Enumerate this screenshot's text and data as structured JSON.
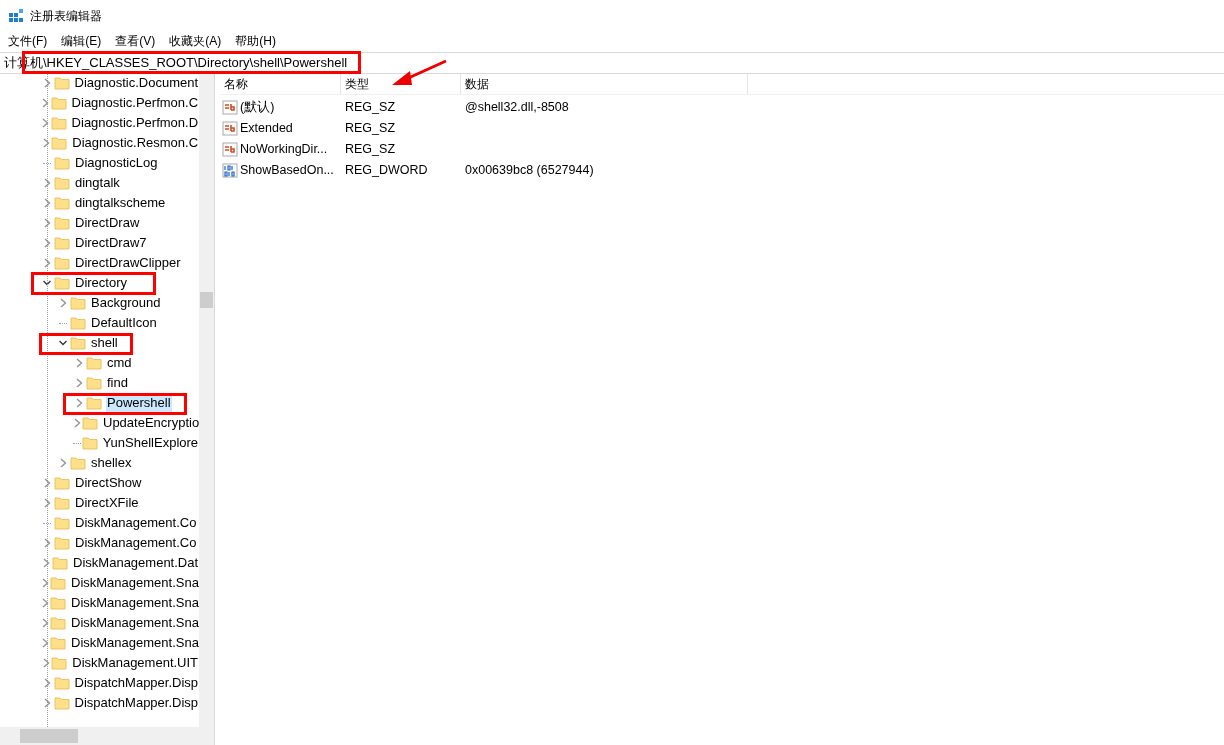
{
  "window": {
    "title": "注册表编辑器"
  },
  "menu": [
    "文件(F)",
    "编辑(E)",
    "查看(V)",
    "收藏夹(A)",
    "帮助(H)"
  ],
  "address": "计算机\\HKEY_CLASSES_ROOT\\Directory\\shell\\Powershell",
  "tree": [
    {
      "label": "Diagnostic.Document",
      "kind": "branch",
      "expanded": false,
      "selected": false
    },
    {
      "label": "Diagnostic.Perfmon.C",
      "kind": "branch",
      "expanded": false,
      "selected": false
    },
    {
      "label": "Diagnostic.Perfmon.D",
      "kind": "branch",
      "expanded": false,
      "selected": false
    },
    {
      "label": "Diagnostic.Resmon.C",
      "kind": "branch",
      "expanded": false,
      "selected": false
    },
    {
      "label": "DiagnosticLog",
      "kind": "leaf",
      "selected": false
    },
    {
      "label": "dingtalk",
      "kind": "branch",
      "expanded": false,
      "selected": false
    },
    {
      "label": "dingtalkscheme",
      "kind": "branch",
      "expanded": false,
      "selected": false
    },
    {
      "label": "DirectDraw",
      "kind": "branch",
      "expanded": false,
      "selected": false
    },
    {
      "label": "DirectDraw7",
      "kind": "branch",
      "expanded": false,
      "selected": false
    },
    {
      "label": "DirectDrawClipper",
      "kind": "branch",
      "expanded": false,
      "selected": false
    },
    {
      "label": "Directory",
      "kind": "branch",
      "expanded": true,
      "selected": false,
      "children": [
        {
          "label": "Background",
          "kind": "branch",
          "expanded": false,
          "selected": false
        },
        {
          "label": "DefaultIcon",
          "kind": "leaf",
          "selected": false
        },
        {
          "label": "shell",
          "kind": "branch",
          "expanded": true,
          "selected": false,
          "children": [
            {
              "label": "cmd",
              "kind": "branch",
              "expanded": false,
              "selected": false
            },
            {
              "label": "find",
              "kind": "branch",
              "expanded": false,
              "selected": false
            },
            {
              "label": "Powershell",
              "kind": "branch",
              "expanded": false,
              "selected": true
            },
            {
              "label": "UpdateEncryptio",
              "kind": "branch",
              "expanded": false,
              "selected": false
            },
            {
              "label": "YunShellExplore",
              "kind": "leaf",
              "selected": false
            }
          ]
        },
        {
          "label": "shellex",
          "kind": "branch",
          "expanded": false,
          "selected": false
        }
      ]
    },
    {
      "label": "DirectShow",
      "kind": "branch",
      "expanded": false,
      "selected": false
    },
    {
      "label": "DirectXFile",
      "kind": "branch",
      "expanded": false,
      "selected": false
    },
    {
      "label": "DiskManagement.Co",
      "kind": "leaf",
      "selected": false
    },
    {
      "label": "DiskManagement.Co",
      "kind": "branch",
      "expanded": false,
      "selected": false
    },
    {
      "label": "DiskManagement.Dat",
      "kind": "branch",
      "expanded": false,
      "selected": false
    },
    {
      "label": "DiskManagement.Sna",
      "kind": "branch",
      "expanded": false,
      "selected": false
    },
    {
      "label": "DiskManagement.Sna",
      "kind": "branch",
      "expanded": false,
      "selected": false
    },
    {
      "label": "DiskManagement.Sna",
      "kind": "branch",
      "expanded": false,
      "selected": false
    },
    {
      "label": "DiskManagement.Sna",
      "kind": "branch",
      "expanded": false,
      "selected": false
    },
    {
      "label": "DiskManagement.UIT",
      "kind": "branch",
      "expanded": false,
      "selected": false
    },
    {
      "label": "DispatchMapper.Disp",
      "kind": "branch",
      "expanded": false,
      "selected": false
    },
    {
      "label": "DispatchMapper.Disp",
      "kind": "branch",
      "expanded": false,
      "selected": false
    }
  ],
  "table": {
    "columns": [
      "名称",
      "类型",
      "数据"
    ],
    "rows": [
      {
        "kind": "string",
        "name": "(默认)",
        "type": "REG_SZ",
        "data": "@shell32.dll,-8508"
      },
      {
        "kind": "string",
        "name": "Extended",
        "type": "REG_SZ"
      },
      {
        "kind": "string",
        "name": "NoWorkingDir...",
        "type": "REG_SZ"
      },
      {
        "kind": "dword",
        "name": "ShowBasedOn...",
        "type": "REG_DWORD",
        "data": "0x00639bc8 (6527944)"
      }
    ]
  }
}
